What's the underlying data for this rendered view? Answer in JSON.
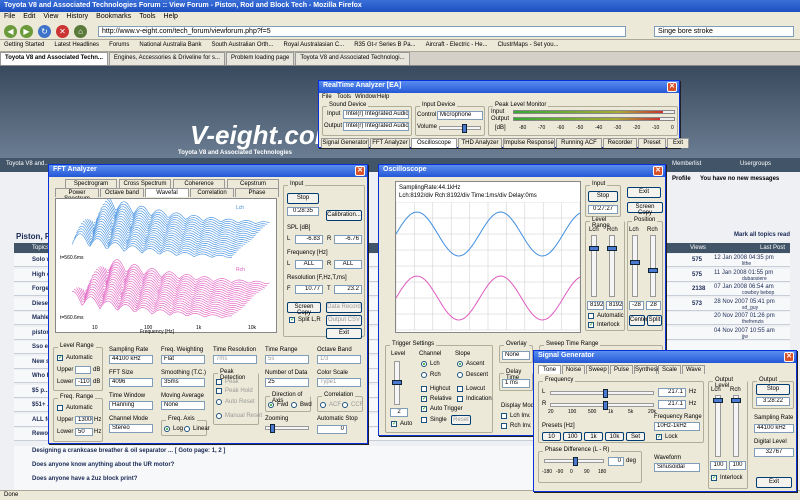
{
  "browser": {
    "title": "Toyota V8 and Associated Technologies Forum :: View Forum - Piston, Rod and Block Tech - Mozilla Firefox",
    "menu": [
      "File",
      "Edit",
      "View",
      "History",
      "Bookmarks",
      "Tools",
      "Help"
    ],
    "url": "http://www.v-eight.com/tech_forum/viewforum.php?f=5",
    "search": "Singe bore stroke",
    "bookmarks": [
      "Getting Started",
      "Latest Headlines",
      "Forums",
      "National Australia Bank",
      "South Australian Orth...",
      "Royal Australasian C...",
      "R35 Gt-r Series B Pa...",
      "Aircraft - Electric - He...",
      "ClustrMaps - Set you..."
    ],
    "tabs": [
      "Toyota V8 and Associated Techn...",
      "Engines, Accessories & Driveline for s...",
      "Problem loading page",
      "Toyota V8 and Associated Technologi..."
    ],
    "status": "Done"
  },
  "forum": {
    "logo": "V-eight.com",
    "logo_sub": "Toyota V8 and Associated Technologies",
    "nav_left": "Toyota V8 and...",
    "memberlist": "Memberlist",
    "usergroups": "Usergroups",
    "profile": "Profile",
    "no_messages": "You have no new messages",
    "section": "Piston, Rod",
    "topics_col": "Topics",
    "views_col": "Views",
    "lastpost_col": "Last Post",
    "mark_read": "Mark all topics read",
    "rows": [
      {
        "title": "Solo w...",
        "views": "575",
        "last": "12 Jan 2008 04:35 pm",
        "by": "lithe"
      },
      {
        "title": "High c...",
        "views": "575",
        "last": "11 Jan 2008 01:55 pm",
        "by": "dubaosiere"
      },
      {
        "title": "Forge...",
        "views": "2138",
        "last": "07 Jan 2008 06:54 am",
        "by": "cowboy bebop"
      },
      {
        "title": "Diesel...",
        "views": "573",
        "last": "28 Nov 2007 05:41 pm",
        "by": "sd_guy"
      },
      {
        "title": "Mahle...",
        "views": "",
        "last": "20 Nov 2007 01:26 pm",
        "by": "thefrenzis"
      },
      {
        "title": "piston...",
        "views": "",
        "last": "04 Nov 2007 10:55 am",
        "by": "jjw"
      },
      {
        "title": "Sso e...",
        "views": "",
        "last": "",
        "by": ""
      },
      {
        "title": "New s...",
        "views": "",
        "last": "",
        "by": ""
      },
      {
        "title": "Who h...",
        "views": "",
        "last": "",
        "by": ""
      },
      {
        "title": "$5 p...",
        "views": "",
        "last": "",
        "by": ""
      },
      {
        "title": "$51+ ...",
        "views": "",
        "last": "",
        "by": ""
      },
      {
        "title": "ALL fo...",
        "views": "",
        "last": "",
        "by": ""
      },
      {
        "title": "Rewo...",
        "views": "",
        "last": "",
        "by": ""
      }
    ],
    "bottom_rows": [
      "Designing a crankcase breather & oil separator ... [ Goto page: 1, 2 ]",
      "Does anyone know anything about the UR motor?",
      "Does anyone have a 2uz block print?"
    ]
  },
  "realtime": {
    "title": "RealTime Analyzer [EA]",
    "menu": [
      "File",
      "Tools",
      "Window",
      "Help"
    ],
    "sound_device": "Sound Device",
    "input_lbl": "Input",
    "output_lbl": "Output",
    "input_dev": "Intel(r) Integrated Audio",
    "output_dev": "Intel(r) Integrated Audio",
    "input_device": "Input Device",
    "control_lbl": "Control",
    "control_val": "Microphone",
    "volume_lbl": "Volume",
    "peak_monitor": "Peak Level Monitor",
    "db_lbl": "[dB]",
    "scale": [
      "-80",
      "-70",
      "-60",
      "-50",
      "-40",
      "-30",
      "-20",
      "-10",
      "0"
    ],
    "input_level": 0.93,
    "output_level": 0.91,
    "tabs": [
      "Signal Generator",
      "FFT Analyzer",
      "Oscilloscope",
      "THD Analyzer",
      "Impulse Response",
      "Running ACF",
      "Recorder",
      "Preset",
      "Exit"
    ]
  },
  "fft": {
    "title": "FFT Analyzer",
    "tabs_row1": [
      "Spectrogram",
      "Cross Spectrum",
      "Coherence",
      "Cepstrum"
    ],
    "tabs_row2": [
      "Power Spectrum",
      "Octave band",
      "Wavefal",
      "Correlation",
      "Phase"
    ],
    "input": "Input",
    "stop": "Stop",
    "time": "0:28:35",
    "calibration": "Calibration...",
    "spl": "SPL [dB]",
    "spl_l": "L",
    "spl_r": "R",
    "spl_l_val": "-6.83",
    "spl_r_val": "-6.76",
    "freq": "Frequency [Hz]",
    "freq_l": "L",
    "freq_r": "R",
    "freq_l_val": "ALL",
    "freq_r_val": "ALL",
    "resolution": "Resolution [F,Hz,T,ms]",
    "res_f": "F",
    "res_t": "T",
    "res_f_val": "10.77",
    "res_t_val": "23.2",
    "screen_copy": "Screen Copy",
    "data_record": "Data Record",
    "output_csv": "Output CSV",
    "split": "Split L,R",
    "exit": "Exit",
    "lch": "Lch",
    "rch": "Rch",
    "t1": "t=560.6ms",
    "t2": "t=560.6ms",
    "freq_axis": "Frequency [Hz]",
    "xticks": [
      "10",
      "100",
      "1k",
      "10k"
    ],
    "level_range": "Level Range",
    "automatic": "Automatic",
    "upper": "Upper",
    "lower": "Lower",
    "upper_val": "",
    "lower_val": "-110",
    "db": "dB",
    "sampling_rate": "Sampling Rate",
    "sr_val": "44100 kHz",
    "fft_size": "FFT Size",
    "fft_val": "4096",
    "time_window": "Time Window",
    "tw_val": "Hanning",
    "channel_mode": "Channel Mode",
    "cm_val": "Stereo",
    "freq_weighting": "Freq. Weighting",
    "fw_val": "Flat",
    "smoothing": "Smoothing (T.C.)",
    "sm_val": "35ms",
    "moving_avg": "Moving Average",
    "ma_val": "None",
    "freq_axis_grp": "Freq. Axis",
    "log": "Log",
    "linear": "Linear",
    "time_res": "Time Resolution",
    "tr_val": "7ms",
    "peak_detection": "Peak Detection",
    "peak": "Peak",
    "peak_hold": "Peak Hold",
    "auto_reset": "Auto Reset",
    "manual_reset": "Manual Reset",
    "time_range": "Time Range",
    "trg_val": "5s",
    "num_data": "Number of Data",
    "nd_val": "25",
    "direction": "Direction of Axis",
    "fwd": "Fwd",
    "bwd": "Bwd",
    "zooming": "Zooming",
    "octave_band": "Octave Band",
    "ob_val": "1/3",
    "color_scale": "Color Scale",
    "cs_val": "Type1",
    "correlation": "Correlation",
    "acf": "ACF",
    "ccf": "CCF",
    "freq_range": "Freq. Range",
    "fr_auto": "Automatic",
    "fr_upper": "Upper",
    "fr_lower": "Lower",
    "fr_upper_val": "13000",
    "fr_lower_val": "50",
    "hz": "Hz",
    "auto_stop": "Automatic Stop",
    "as_val": "0"
  },
  "osc": {
    "title": "Oscilloscope",
    "info1": "SamplingRate:44.1kHz",
    "info2": "Lch:8192/div Rch:8192/div Time:1ms/div Delay:0ms",
    "input": "Input",
    "stop": "Stop",
    "time": "0:27:27",
    "exit": "Exit",
    "screen_copy": "Screen Copy",
    "level_range": "Level Range",
    "position": "Position",
    "lch": "Lch",
    "rch": "Rch",
    "lr1": "8192",
    "lr2": "8192",
    "p1": "-28",
    "p2": "28",
    "automatic": "Automatic",
    "interlock": "Interlock",
    "center": "Center",
    "split": "Split",
    "trigger": "Trigger Settings",
    "level": "Level",
    "channel": "Channel",
    "slope": "Slope",
    "ascent": "Ascent",
    "descent": "Descent",
    "highcut": "Highcut",
    "lowcut": "Lowcut",
    "relative": "Relative",
    "indication": "Indication",
    "auto_trigger": "Auto Trigger",
    "single": "Single",
    "reset": "Reset",
    "auto": "Auto",
    "level_val": "2",
    "overlay": "Overlay",
    "overlay_val": "None",
    "delay_time": "Delay Time",
    "delay_val": "1 ms",
    "display_mode": "Display Mode",
    "lchinv": "Lch Inv.",
    "rchinv": "Rch Inv.",
    "sweep": "Sweep Time Range"
  },
  "siggen": {
    "title": "Signal Generator",
    "tabs": [
      "Tone",
      "Noise",
      "Sweep",
      "Pulse",
      "Synthesis",
      "Scale",
      "Wave"
    ],
    "frequency": "Frequency",
    "l": "L",
    "r": "R",
    "l_val": "217.1",
    "r_val": "217.1",
    "hz": "Hz",
    "scale": [
      "20",
      "100",
      "500",
      "1k",
      "5k",
      "20k"
    ],
    "freq_range": "Frequency Range",
    "fr_val": "10Hz-1kHz",
    "presets": "Presets [Hz]",
    "preset_btns": [
      "10",
      "100",
      "1k",
      "10k",
      "Set"
    ],
    "lock": "Lock",
    "phase": "Phase Difference (L - R)",
    "phase_val": "0",
    "deg": "deg",
    "phase_scale": [
      "-180",
      "-90",
      "0",
      "90",
      "180"
    ],
    "waveform": "Waveform",
    "wf_val": "Sinusoidal",
    "output_level": "Output Level",
    "lch": "Lch",
    "rch": "Rch",
    "ol_l": "100",
    "ol_r": "100",
    "interlock": "Interlock",
    "output": "Output",
    "stop": "Stop",
    "time": "3:28:22",
    "sampling_rate": "Sampling Rate",
    "sr_val": "44100 kHz",
    "digital_level": "Digital Level",
    "dl_val": "32767",
    "exit": "Exit"
  },
  "colors": {
    "fft_l": "#3f8ee0",
    "fft_r": "#e05abf",
    "osc_l": "#3f8ee0",
    "osc_r": "#e05abf",
    "accent": "#2458d6"
  }
}
